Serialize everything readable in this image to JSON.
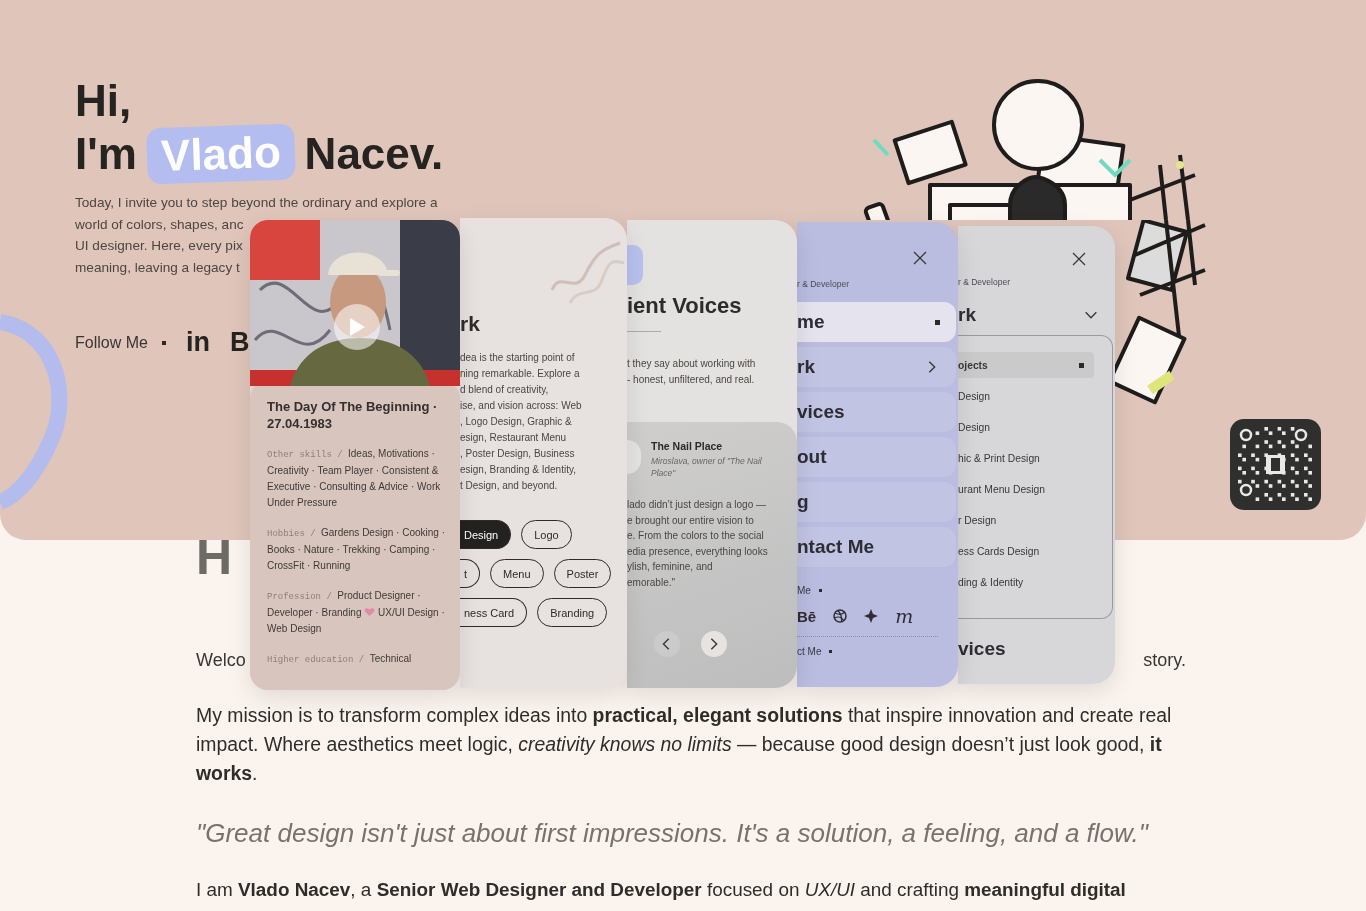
{
  "hero": {
    "greeting": "Hi,",
    "intro_word": "I'm",
    "highlight": "Vlado",
    "surname": "Nacev.",
    "intro_lines": [
      "Today, I invite you to step beyond the ordinary and explore a",
      "world of colors, shapes, anc",
      "UI designer. Here, every pix",
      "meaning, leaving a legacy t"
    ],
    "follow_label": "Follow Me",
    "social": [
      "in",
      "B"
    ]
  },
  "cards": [
    {
      "kind": "profile",
      "title": "The Day Of The Beginning · 27.04.1983",
      "facts": [
        {
          "label": "Other skills /",
          "value": "Ideas, Motivations · Creativity · Team Player · Consistent & Executive · Consulting & Advice · Work Under Pressure"
        },
        {
          "label": "Hobbies /",
          "value": "Gardens Design · Cooking · Books · Nature · Trekking · Camping · CrossFit · Running"
        },
        {
          "label": "Profession /",
          "value": "Product Designer · Developer · Branding",
          "value_after": "UX/UI Design · Web Design"
        },
        {
          "label": "Higher education /",
          "value": "Technical"
        }
      ]
    },
    {
      "kind": "work",
      "heading": "rk",
      "lines": [
        "dea is the starting point of",
        "ning remarkable. Explore a",
        "d blend of creativity,",
        "ise, and vision across: Web",
        ", Logo Design, Graphic &",
        "esign, Restaurant Menu",
        ", Poster Design, Business",
        "esign, Branding & Identity,",
        "t Design, and beyond."
      ],
      "tag_rows": [
        [
          {
            "label": "Design",
            "selected": true,
            "cut": true
          },
          {
            "label": "Logo",
            "selected": false,
            "cut": false
          }
        ],
        [
          {
            "label": "t",
            "selected": false,
            "cut": true
          },
          {
            "label": "Menu",
            "selected": false,
            "cut": false
          },
          {
            "label": "Poster",
            "selected": false,
            "cut": false
          }
        ],
        [
          {
            "label": "ness Card",
            "selected": false,
            "cut": true
          },
          {
            "label": "Branding",
            "selected": false,
            "cut": false
          }
        ]
      ]
    },
    {
      "kind": "testimonials",
      "heading": "ient Voices",
      "lines": [
        "t they say about working with",
        "- honest, unfiltered, and real."
      ],
      "client": "The Nail Place",
      "author": "Miroslava, owner of \"The Nail Place\"",
      "quote_lines": [
        "lado didn’t just design a logo —",
        "e brought our entire vision to",
        "e. From the colors to the social",
        "edia presence, everything looks",
        "ylish, feminine, and",
        "emorable.\""
      ]
    },
    {
      "kind": "menu",
      "subtitle": "r & Developer",
      "items": [
        {
          "label": "me",
          "selected": true,
          "expandable": false
        },
        {
          "label": "rk",
          "selected": false,
          "expandable": true
        },
        {
          "label": "vices",
          "selected": false,
          "expandable": false
        },
        {
          "label": "out",
          "selected": false,
          "expandable": false
        },
        {
          "label": "g",
          "selected": false,
          "expandable": false
        },
        {
          "label": "ntact Me",
          "selected": false,
          "expandable": false
        }
      ],
      "follow_label": "Me",
      "social": [
        {
          "kind": "text",
          "label": "Bē"
        },
        {
          "kind": "ball"
        },
        {
          "kind": "sparkle"
        },
        {
          "kind": "script",
          "label": "m"
        }
      ],
      "contact_label": "ct Me"
    },
    {
      "kind": "submenu",
      "subtitle": "r & Developer",
      "open_item": "rk",
      "subitems": [
        {
          "label": "ojects",
          "selected": true
        },
        {
          "label": "Design",
          "selected": false
        },
        {
          "label": "Design",
          "selected": false
        },
        {
          "label": "hic & Print Design",
          "selected": false
        },
        {
          "label": "urant Menu Design",
          "selected": false
        },
        {
          "label": "r Design",
          "selected": false
        },
        {
          "label": "ess Cards Design",
          "selected": false
        },
        {
          "label": "ding & Identity",
          "selected": false
        }
      ],
      "next_item": "vices"
    }
  ],
  "main": {
    "heading_fragment": "H",
    "welcome_start": "Welco",
    "welcome_end": "story.",
    "mission": "My mission is to transform complex ideas into **practical, elegant solutions** that inspire innovation and create real impact. Where aesthetics meet logic, *creativity knows no limits* — because good design doesn’t just look good, **it works**.",
    "quote": "\"Great design isn't just about first impressions. It's a solution, a feeling, and a flow.\"",
    "about": "I am **Vlado Nacev**, a **Senior Web Designer and Developer** focused on *UX/UI* and crafting **meaningful digital**"
  }
}
